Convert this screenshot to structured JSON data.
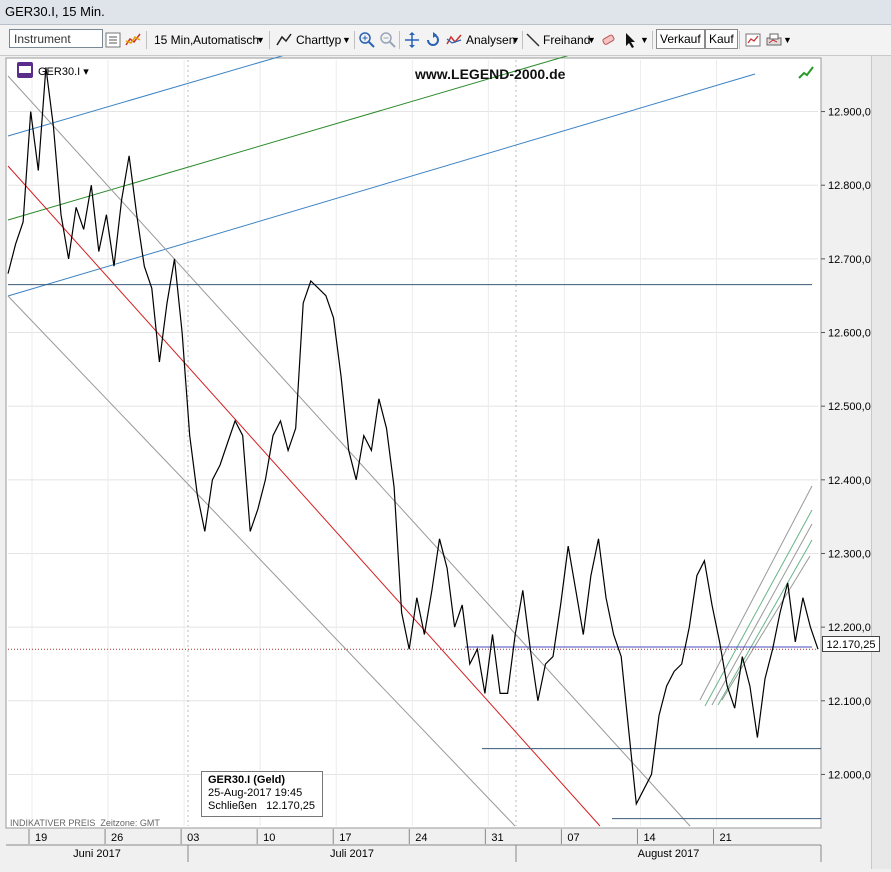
{
  "window": {
    "title": "GER30.I, 15 Min."
  },
  "toolbar": {
    "instrument_placeholder": "Instrument",
    "interval_label": "15 Min,",
    "mode_label": "Automatisch",
    "charttype_label": "Charttyp",
    "analysen_label": "Analysen",
    "freihand_label": "Freihand",
    "verkauf_label": "Verkauf",
    "kauf_label": "Kauf"
  },
  "chart": {
    "symbol": "GER30.I",
    "watermark": "www.LEGEND-2000.de",
    "footnote_price_type": "INDIKATIVER PREIS",
    "footnote_timezone": "Zeitzone: GMT",
    "last_price_tag": "12.170,25",
    "info_box": {
      "title": "GER30.I (Geld)",
      "datetime": "25-Aug-2017 19:45",
      "close_label": "Schließen",
      "close_value": "12.170,25"
    }
  },
  "chart_data": {
    "type": "line",
    "title": "",
    "xlabel": "",
    "ylabel": "",
    "ylim": [
      11930,
      12970
    ],
    "y_ticks": [
      "12.000,00",
      "12.100,00",
      "12.200,00",
      "12.300,00",
      "12.400,00",
      "12.500,00",
      "12.600,00",
      "12.700,00",
      "12.800,00",
      "12.900,00"
    ],
    "x_day_ticks": [
      "19",
      "26",
      "03",
      "10",
      "17",
      "24",
      "31",
      "07",
      "14",
      "21"
    ],
    "x_month_labels": [
      "Juni 2017",
      "Juli 2017",
      "August 2017"
    ],
    "series": [
      {
        "values": [
          12680,
          12720,
          12750,
          12900,
          12820,
          12960,
          12880,
          12760,
          12700,
          12770,
          12740,
          12800,
          12710,
          12760,
          12690,
          12780,
          12840,
          12760,
          12690,
          12660,
          12560,
          12640,
          12700,
          12600,
          12460,
          12380,
          12330,
          12400,
          12420,
          12450,
          12480,
          12460,
          12330,
          12360,
          12400,
          12460,
          12480,
          12440,
          12470,
          12640,
          12670,
          12660,
          12650,
          12620,
          12540,
          12440,
          12400,
          12460,
          12440,
          12510,
          12470,
          12390,
          12220,
          12170,
          12240,
          12190,
          12250,
          12320,
          12280,
          12200,
          12230,
          12150,
          12170,
          12110,
          12190,
          12110,
          12110,
          12190,
          12250,
          12170,
          12100,
          12150,
          12160,
          12230,
          12310,
          12250,
          12190,
          12270,
          12320,
          12240,
          12190,
          12160,
          12060,
          11960,
          11980,
          12000,
          12080,
          12120,
          12140,
          12150,
          12200,
          12270,
          12290,
          12230,
          12180,
          12120,
          12090,
          12160,
          12120,
          12050,
          12130,
          12170,
          12220,
          12260,
          12180,
          12240,
          12200,
          12170
        ]
      }
    ],
    "horizontal_levels": [
      12665,
      12173,
      12035,
      11940
    ]
  }
}
